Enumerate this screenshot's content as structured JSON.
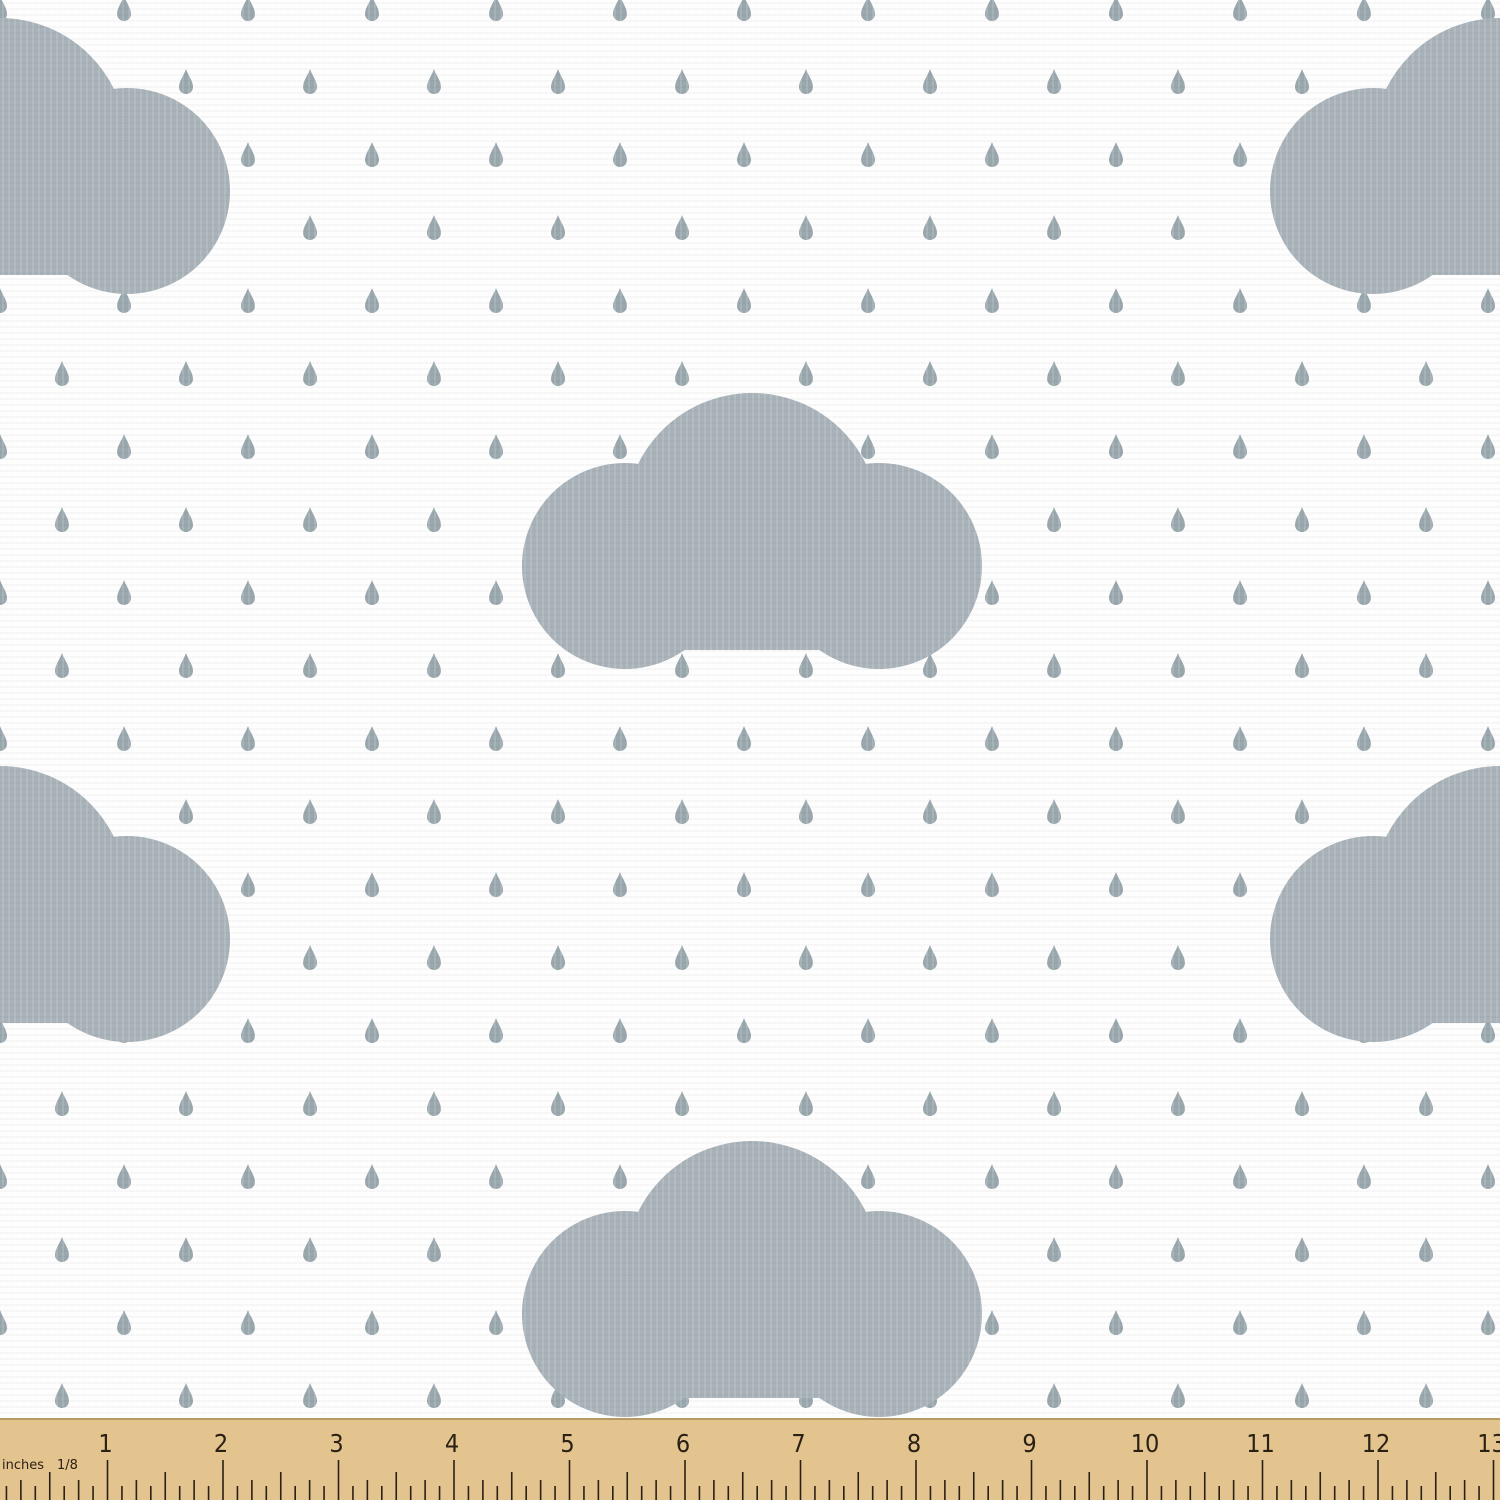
{
  "colors": {
    "fabric_background": "#fdfdfd",
    "cloud": "#a8b2b8",
    "raindrop": "#9aa8ae",
    "ruler_wood": "#e3c48e",
    "ruler_ink": "#2a2014"
  },
  "pattern": {
    "motif": "rain clouds with raindrops",
    "texture": "woven canvas"
  },
  "ruler": {
    "unit_label": "inches",
    "fraction_label": "1/8",
    "numbers": [
      "1",
      "2",
      "3",
      "4",
      "5",
      "6",
      "7",
      "8",
      "9",
      "10",
      "11",
      "12",
      "13"
    ]
  }
}
